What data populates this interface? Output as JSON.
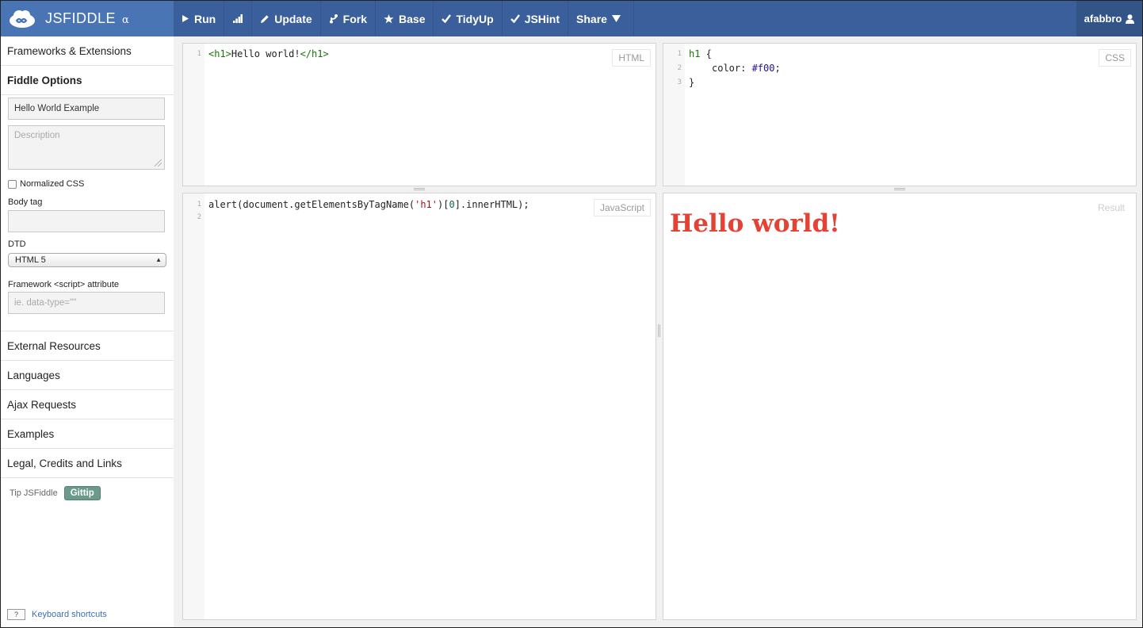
{
  "brand": {
    "name": "JSFIDDLE",
    "alpha": "α",
    "logo_icon": "cloud-logo-icon"
  },
  "toolbar": {
    "run": "Run",
    "update": "Update",
    "fork": "Fork",
    "base": "Base",
    "tidyup": "TidyUp",
    "jshint": "JSHint",
    "share": "Share"
  },
  "user": {
    "name": "afabbro",
    "icon": "user-icon"
  },
  "sidebar": {
    "frameworks": "Frameworks & Extensions",
    "fiddle_options": "Fiddle Options",
    "title_value": "Hello World Example",
    "description_placeholder": "Description",
    "normalized_css": "Normalized CSS",
    "body_tag_label": "Body tag",
    "body_tag_value": "",
    "dtd_label": "DTD",
    "dtd_value": "HTML 5",
    "framework_attr_label": "Framework <script> attribute",
    "framework_attr_placeholder": "ie. data-type=\"\"",
    "sections": [
      "External Resources",
      "Languages",
      "Ajax Requests",
      "Examples",
      "Legal, Credits and Links"
    ],
    "tip_label": "Tip JSFiddle",
    "gittip": "Gittip",
    "shortcut_key": "?",
    "shortcuts_link": "Keyboard shortcuts"
  },
  "panels": {
    "html": {
      "label": "HTML",
      "line_numbers": [
        "1"
      ],
      "open_tag": "<h1>",
      "text": "Hello world!",
      "close_tag": "</h1>"
    },
    "css": {
      "label": "CSS",
      "line_numbers": [
        "1",
        "2",
        "3"
      ],
      "selector": "h1",
      "open_brace": " {",
      "property": "color",
      "value": "#f00",
      "close_brace": "}"
    },
    "js": {
      "label": "JavaScript",
      "line_numbers": [
        "1",
        "2"
      ],
      "pre": "alert(document.getElementsByTagName(",
      "string": "'h1'",
      "mid": ")[",
      "index": "0",
      "post": "].innerHTML);"
    },
    "result": {
      "label": "Result",
      "heading": "Hello world!",
      "heading_color": "#e34234"
    }
  },
  "colors": {
    "topbar": "#3a5f9a",
    "brand_bg": "#4a75b5",
    "gittip": "#6a9a8a"
  }
}
